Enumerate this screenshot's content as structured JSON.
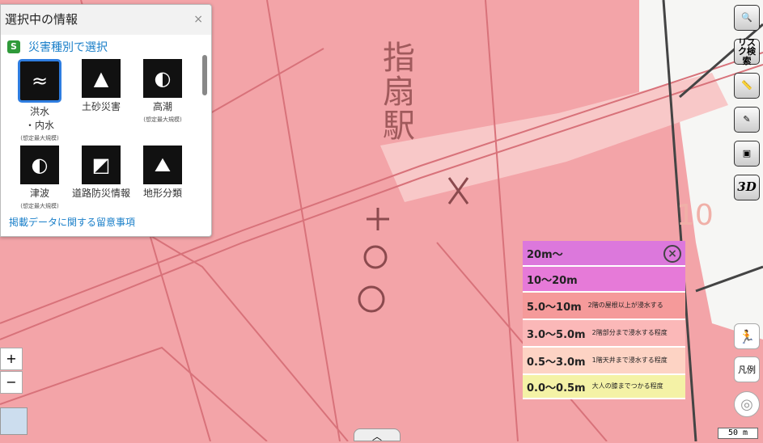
{
  "map": {
    "station_label": "指扇駅",
    "height_label": "10"
  },
  "panel": {
    "title": "選択中の情報",
    "close": "×",
    "section_icon": "S",
    "section_title": "災害種別で選択",
    "items": [
      {
        "label": "洪水",
        "label2": "・内水",
        "note": "(想定最大規模)",
        "icon": "flood-icon",
        "glyph": "≈"
      },
      {
        "label": "土砂災害",
        "label2": "",
        "note": "",
        "icon": "landslide-icon",
        "glyph": "▲"
      },
      {
        "label": "高潮",
        "label2": "",
        "note": "(想定最大規模)",
        "icon": "storm-surge-icon",
        "glyph": "◐"
      },
      {
        "label": "津波",
        "label2": "",
        "note": "(想定最大規模)",
        "icon": "tsunami-icon",
        "glyph": "◐"
      },
      {
        "label": "道路防災情報",
        "label2": "",
        "note": "",
        "icon": "road-icon",
        "glyph": "◩"
      },
      {
        "label": "地形分類",
        "label2": "",
        "note": "",
        "icon": "terrain-icon",
        "glyph": "⛰"
      }
    ],
    "more_link": "掲載データに関する留意事項"
  },
  "tools": {
    "search": "🔍",
    "risk": "リスク検索",
    "ruler": "📏",
    "pen": "✎",
    "toolbox": "▣",
    "three_d": "3D"
  },
  "legend": {
    "close": "×",
    "rows": [
      {
        "range": "20m～",
        "desc": "",
        "color": "#dc78dc"
      },
      {
        "range": "10～20m",
        "desc": "",
        "color": "#e67ad8"
      },
      {
        "range": "5.0～10m",
        "desc": "2階の屋根以上が浸水する",
        "color": "#f59a9a"
      },
      {
        "range": "3.0～5.0m",
        "desc": "2階部分まで浸水する程度",
        "color": "#fbb8b8"
      },
      {
        "range": "0.5～3.0m",
        "desc": "1階天井まで浸水する程度",
        "color": "#fdd3c4"
      },
      {
        "range": "0.0～0.5m",
        "desc": "大人の膝までつかる程度",
        "color": "#f4f2a6"
      }
    ]
  },
  "controls": {
    "zoom_in": "+",
    "zoom_out": "−",
    "evac": "🏃",
    "legend": "凡例",
    "locate": "◎",
    "scale": "50 m",
    "collapse": "︿"
  }
}
